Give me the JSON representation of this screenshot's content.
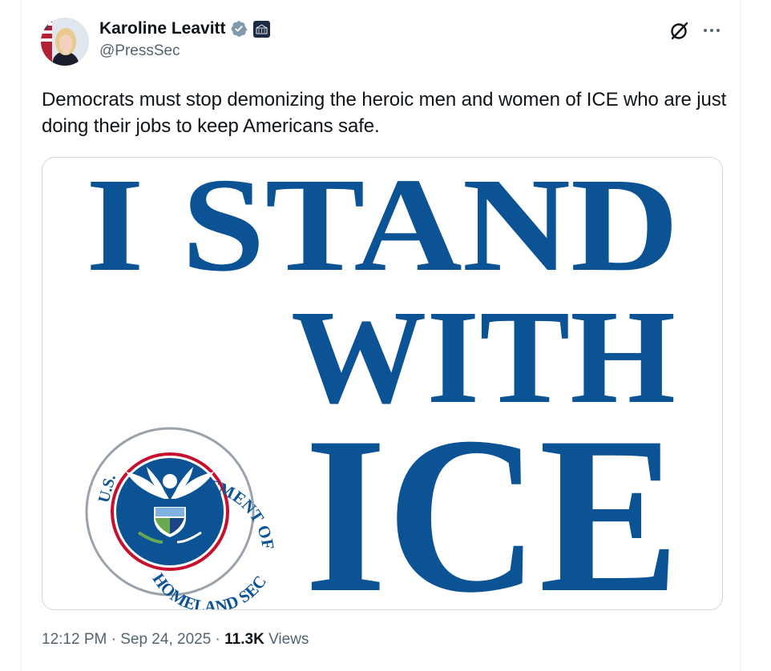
{
  "author": {
    "display_name": "Karoline Leavitt",
    "handle": "@PressSec"
  },
  "tweet": {
    "text": "Democrats must stop demonizing the heroic men and women of ICE who are just doing their jobs to keep Americans safe."
  },
  "media": {
    "line1": "I STAND",
    "line2": "WITH",
    "line3": "ICE",
    "seal_top_text": "DEPARTMENT OF",
    "seal_left_text": "U.S.",
    "seal_bottom_text": "HOMELAND SECURITY",
    "color": "#0b5394"
  },
  "meta": {
    "time": "12:12 PM",
    "date": "Sep 24, 2025",
    "views_count": "11.3K",
    "views_label": "Views",
    "separator": "·"
  },
  "icons": {
    "verified": "verified-badge-icon",
    "affiliation": "white-house-affiliation-icon",
    "grok": "grok-icon",
    "more": "more-horizontal-icon"
  },
  "colors": {
    "text_primary": "#0f1419",
    "text_secondary": "#536471",
    "verified_badge": "#829aab",
    "seal_red": "#c8102e",
    "ice_blue": "#0b5394"
  }
}
